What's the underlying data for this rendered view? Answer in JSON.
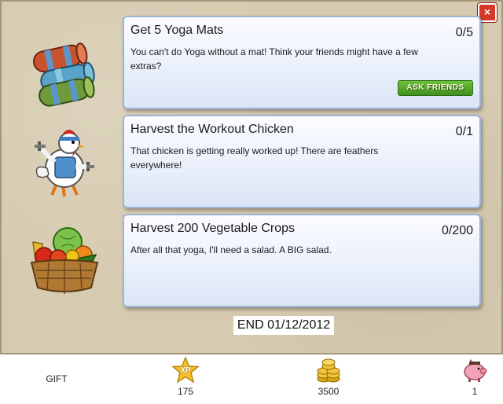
{
  "close_label": "×",
  "quests": [
    {
      "title": "Get 5 Yoga Mats",
      "description": "You can't do Yoga without a mat! Think your friends might have a few extras?",
      "progress": "0/5",
      "icon": "yoga-mats-icon",
      "button_label": "ASK FRIENDS"
    },
    {
      "title": "Harvest the Workout Chicken",
      "description": "That chicken is getting really worked up! There are feathers everywhere!",
      "progress": "0/1",
      "icon": "workout-chicken-icon"
    },
    {
      "title": "Harvest 200 Vegetable Crops",
      "description": "After all that yoga, I'll need a salad. A BIG salad.",
      "progress": "0/200",
      "icon": "vegetable-basket-icon"
    }
  ],
  "end_date": "END 01/12/2012",
  "rewards": {
    "gift_label": "GIFT",
    "xp_icon_text": "XP",
    "xp_value": "175",
    "coins_value": "3500",
    "pig_value": "1"
  },
  "colors": {
    "panel_bg": "#d6cbb0",
    "card_border": "#9eb4d4",
    "button_green": "#4fa82a",
    "close_red": "#d33a2c"
  }
}
